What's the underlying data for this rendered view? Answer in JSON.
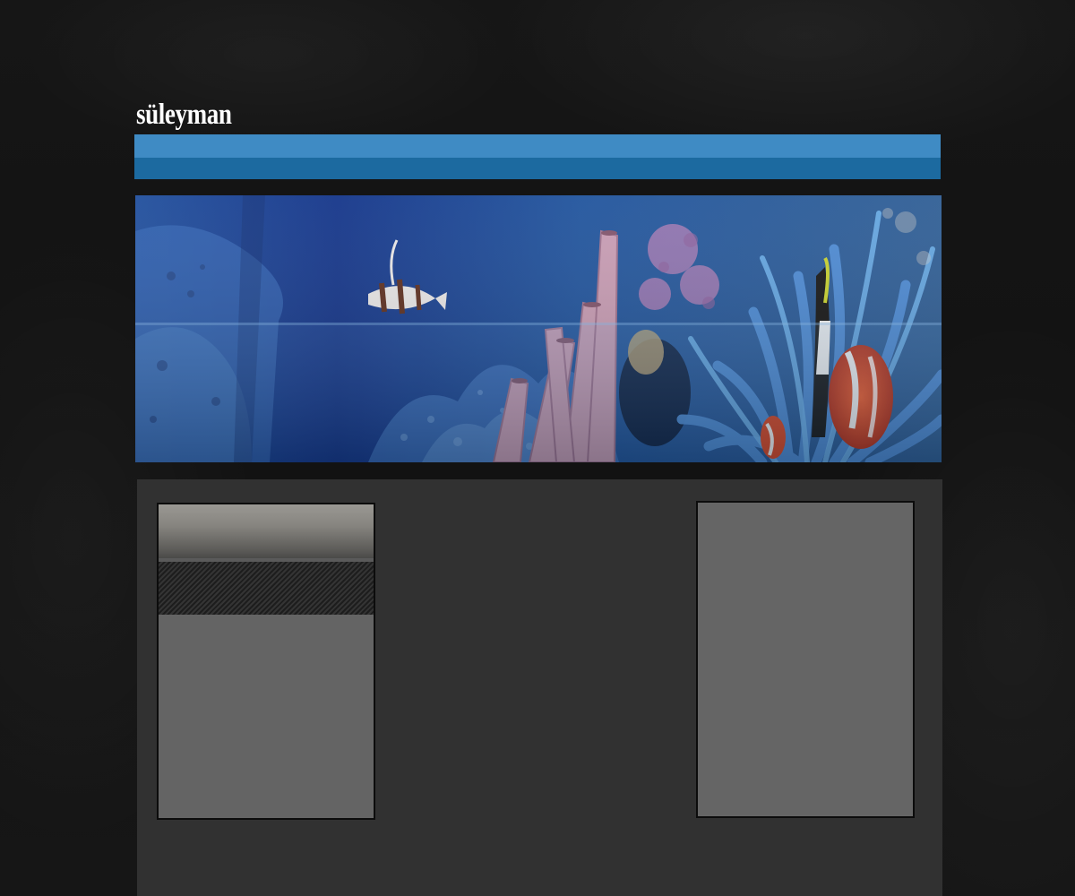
{
  "header": {
    "site_title": "süleyman"
  },
  "navbar": {
    "colors": {
      "top": "#3f8bc4",
      "bottom": "#1c6aa0"
    }
  },
  "banner": {
    "image": "coral-reef-with-fish",
    "colors": {
      "water": "#0e3f8f",
      "coral_pink": "#c28fa8",
      "anemone": "#3d7fd0",
      "clownfish": "#d8431f"
    }
  },
  "content": {
    "left_box": {},
    "right_box": {}
  }
}
